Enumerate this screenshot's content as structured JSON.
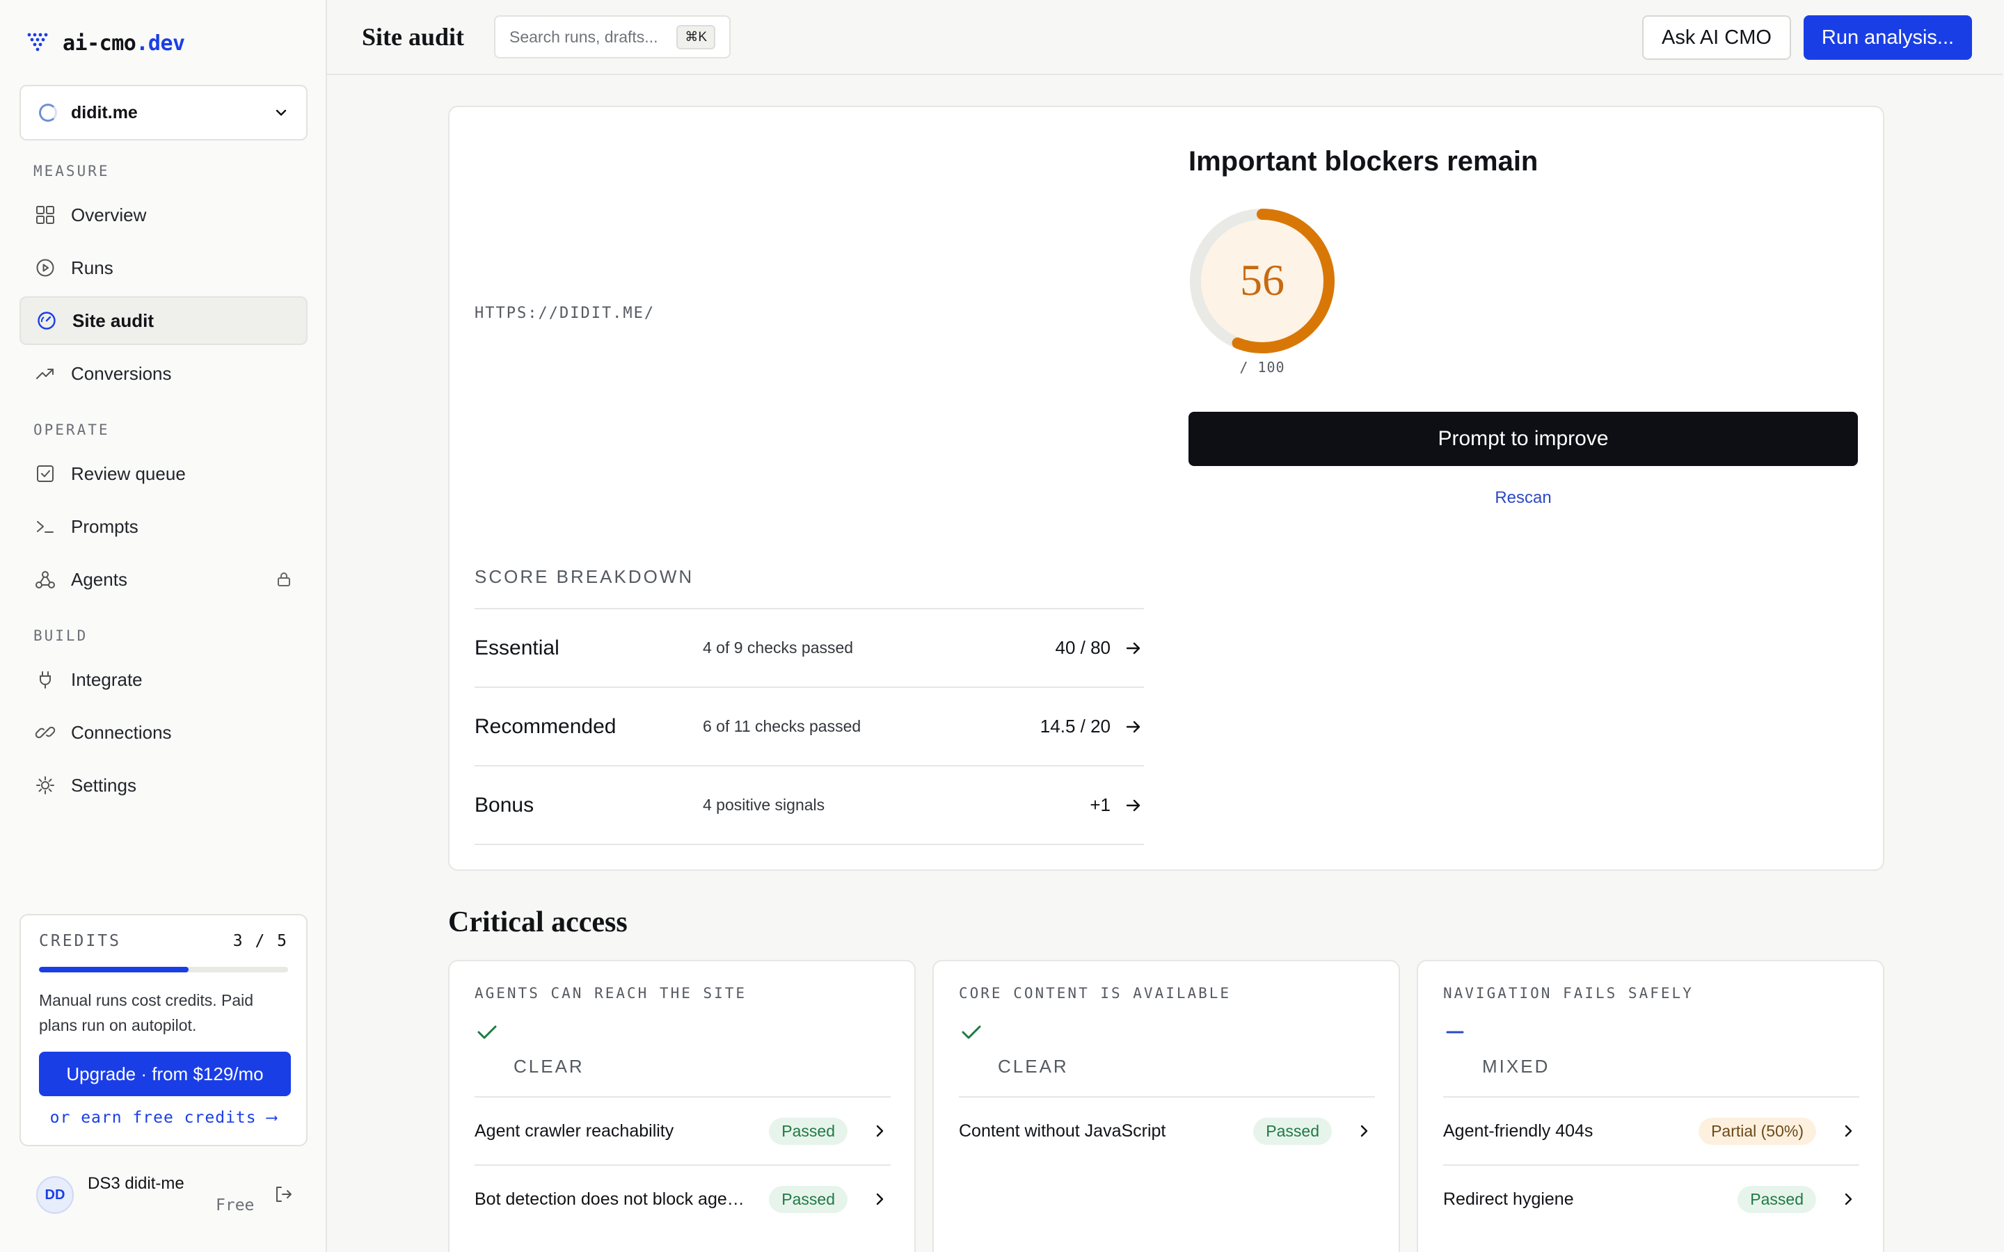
{
  "brand": {
    "name_main": "ai-cmo",
    "name_suffix": ".dev"
  },
  "site_selector": {
    "value": "didit.me"
  },
  "sidebar": {
    "sections": [
      "MEASURE",
      "OPERATE",
      "BUILD"
    ],
    "items": [
      {
        "label": "Overview",
        "icon": "grid-icon"
      },
      {
        "label": "Runs",
        "icon": "play-circle-icon"
      },
      {
        "label": "Site audit",
        "icon": "gauge-icon",
        "active": true
      },
      {
        "label": "Conversions",
        "icon": "trending-up-icon"
      },
      {
        "label": "Review queue",
        "icon": "check-square-icon"
      },
      {
        "label": "Prompts",
        "icon": "terminal-icon"
      },
      {
        "label": "Agents",
        "icon": "agents-icon",
        "locked": true
      },
      {
        "label": "Integrate",
        "icon": "plug-icon"
      },
      {
        "label": "Connections",
        "icon": "link-icon"
      },
      {
        "label": "Settings",
        "icon": "gear-icon"
      }
    ]
  },
  "credits": {
    "label": "CREDITS",
    "count": "3 / 5",
    "used": 3,
    "total": 5,
    "description": "Manual runs cost credits. Paid plans run on autopilot.",
    "upgrade_label": "Upgrade · from $129/mo",
    "earn_label": "or earn free credits ⟶"
  },
  "user": {
    "initials": "DD",
    "name": "DS3 didit-me",
    "plan": "Free"
  },
  "topbar": {
    "title": "Site audit",
    "search_placeholder": "Search runs, drafts...",
    "search_shortcut": "⌘K",
    "ask_label": "Ask AI CMO",
    "run_label": "Run analysis..."
  },
  "audit": {
    "url": "HTTPS://DIDIT.ME/",
    "verdict": "Important blockers remain",
    "score": 56,
    "score_max_label": "/ 100",
    "score_max": 100,
    "score_color": "#d97706",
    "prompt_label": "Prompt to improve",
    "rescan_label": "Rescan",
    "breakdown_label": "SCORE BREAKDOWN",
    "breakdown": [
      {
        "name": "Essential",
        "desc": "4 of 9 checks passed",
        "score": "40 / 80"
      },
      {
        "name": "Recommended",
        "desc": "6 of 11 checks passed",
        "score": "14.5 / 20"
      },
      {
        "name": "Bonus",
        "desc": "4 positive signals",
        "score": "+1"
      }
    ]
  },
  "critical_access": {
    "title": "Critical access",
    "cards": [
      {
        "title": "AGENTS CAN REACH THE SITE",
        "status": "CLEAR",
        "mark": "check-icon",
        "checks": [
          {
            "name": "Agent crawler reachability",
            "status": "Passed",
            "kind": "pass"
          },
          {
            "name": "Bot detection does not block agents",
            "status": "Passed",
            "kind": "pass"
          }
        ]
      },
      {
        "title": "CORE CONTENT IS AVAILABLE",
        "status": "CLEAR",
        "mark": "check-icon",
        "checks": [
          {
            "name": "Content without JavaScript",
            "status": "Passed",
            "kind": "pass"
          }
        ]
      },
      {
        "title": "NAVIGATION FAILS SAFELY",
        "status": "MIXED",
        "mark": "dash-icon",
        "checks": [
          {
            "name": "Agent-friendly 404s",
            "status": "Partial (50%)",
            "kind": "partial"
          },
          {
            "name": "Redirect hygiene",
            "status": "Passed",
            "kind": "pass"
          }
        ]
      }
    ]
  },
  "colors": {
    "accent": "#1a3ee6",
    "success": "#1f7a43",
    "warning": "#d97706"
  }
}
